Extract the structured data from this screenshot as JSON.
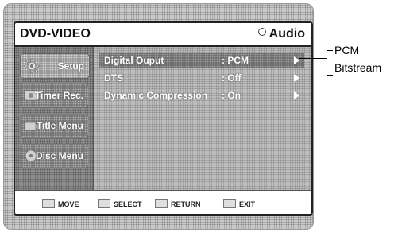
{
  "header": {
    "title": "DVD-VIDEO",
    "mode": "Audio"
  },
  "sidebar": {
    "items": [
      {
        "label": "Setup",
        "icon": "gear-icon",
        "active": true
      },
      {
        "label": "Timer Rec.",
        "icon": "timer-icon",
        "active": false
      },
      {
        "label": "Title Menu",
        "icon": "title-icon",
        "active": false
      },
      {
        "label": "Disc Menu",
        "icon": "disc-icon",
        "active": false
      }
    ]
  },
  "menu": {
    "rows": [
      {
        "label": "Digital Ouput",
        "value": ": PCM",
        "selected": true
      },
      {
        "label": "DTS",
        "value": ": Off",
        "selected": false
      },
      {
        "label": "Dynamic Compression",
        "value": ": On",
        "selected": false
      }
    ]
  },
  "footer": {
    "items": [
      {
        "label": "MOVE",
        "icon": "move-icon"
      },
      {
        "label": "SELECT",
        "icon": "select-icon"
      },
      {
        "label": "RETURN",
        "icon": "return-icon"
      },
      {
        "label": "EXIT",
        "icon": "exit-icon"
      }
    ]
  },
  "callout": {
    "options": [
      "PCM",
      "Bitstream"
    ]
  }
}
